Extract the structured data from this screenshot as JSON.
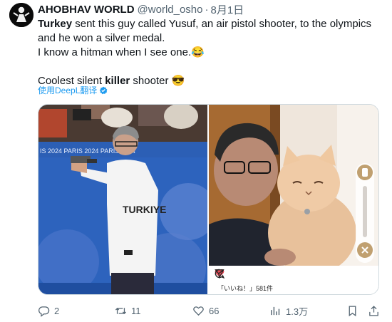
{
  "author": {
    "display_name": "AHOBHAV WORLD",
    "handle": "@world_osho",
    "separator": "·",
    "date": "8月1日"
  },
  "tweet": {
    "line1_bold": "Turkey",
    "line1_rest": " sent this guy called Yusuf, an air pistol shooter, to the olympics and he won a silver medal.",
    "line2": "I know a hitman when I see one.😂",
    "line3_start": "Coolest silent ",
    "line3_bold": "killer",
    "line3_end": " shooter 😎"
  },
  "translate_link": "使用DeepL翻译",
  "media": {
    "left_photo": {
      "banner_text": "IS 2024   PARIS 2024   PARIS 2024",
      "shirt_text": "TURKIYE"
    },
    "right_photo": {
      "likes_label": "「いいね！」581件"
    }
  },
  "actions": {
    "reply_count": "2",
    "retweet_count": "11",
    "like_count": "66",
    "views_count": "1.3万"
  },
  "colors": {
    "link": "#1d9bf0",
    "muted": "#536471",
    "like_red": "#ed4956"
  }
}
